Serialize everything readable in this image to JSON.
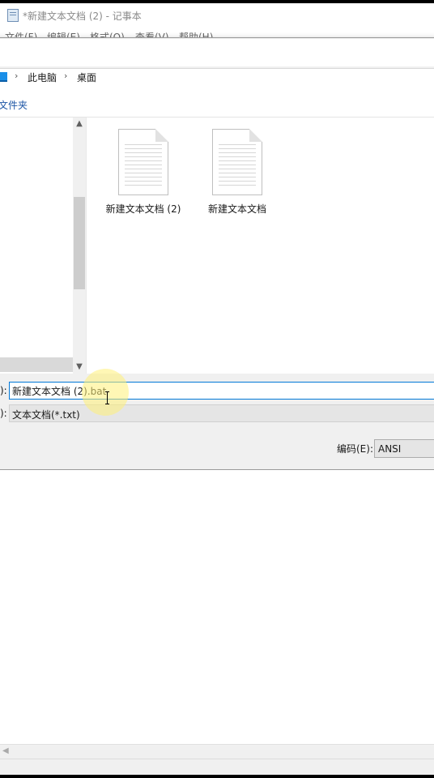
{
  "notepad": {
    "title": "*新建文本文档 (2) - 记事本",
    "menu": [
      "文件(F)",
      "编辑(E)",
      "格式(O)",
      "查看(V)",
      "帮助(H)"
    ]
  },
  "dialog": {
    "breadcrumb": [
      "此电脑",
      "桌面"
    ],
    "new_folder": "文件夹",
    "files": [
      {
        "name": "新建文本文档 (2)"
      },
      {
        "name": "新建文本文档"
      }
    ],
    "filename_label_fragment": "):",
    "filename_value": "新建文本文档 (2).bat",
    "filetype_label_fragment": "):",
    "filetype_value": "文本文档(*.txt)",
    "encoding_label": "编码(E):",
    "encoding_value": "ANSI"
  },
  "colors": {
    "accent": "#0078d7",
    "link": "#1d56a6",
    "highlight": "#fff078"
  }
}
